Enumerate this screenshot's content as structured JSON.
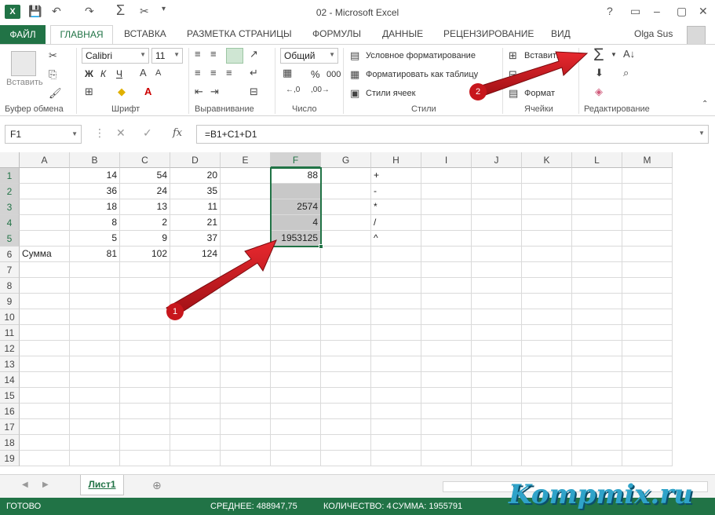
{
  "window": {
    "title": "02 - Microsoft Excel",
    "help": "?",
    "user": "Olga Sus"
  },
  "ribbon_tabs": [
    "ФАЙЛ",
    "ГЛАВНАЯ",
    "ВСТАВКА",
    "РАЗМЕТКА СТРАНИЦЫ",
    "ФОРМУЛЫ",
    "ДАННЫЕ",
    "РЕЦЕНЗИРОВАНИЕ",
    "ВИД"
  ],
  "ribbon": {
    "paste_label": "Вставить",
    "font_name": "Calibri",
    "font_size": "11",
    "bold": "Ж",
    "italic": "К",
    "underline": "Ч",
    "number_format": "Общий",
    "currency": "💳",
    "percent": "%",
    "thousands": "000",
    "cond_format": "Условное форматирование",
    "format_table": "Форматировать как таблицу",
    "cell_styles": "Стили ячеек",
    "insert": "Вставить",
    "format": "Формат",
    "groups": {
      "clipboard": "Буфер обмена",
      "font": "Шрифт",
      "alignment": "Выравнивание",
      "number": "Число",
      "styles": "Стили",
      "cells": "Ячейки",
      "editing": "Редактирование"
    }
  },
  "formula_bar": {
    "name_box": "F1",
    "fx": "fx",
    "formula": "=B1+C1+D1"
  },
  "grid": {
    "columns": [
      "A",
      "B",
      "C",
      "D",
      "E",
      "F",
      "G",
      "H",
      "I",
      "J",
      "K",
      "L",
      "M"
    ],
    "rows": [
      "1",
      "2",
      "3",
      "4",
      "5",
      "6",
      "7",
      "8",
      "9",
      "10",
      "11",
      "12",
      "13",
      "14",
      "15",
      "16",
      "17",
      "18",
      "19"
    ],
    "cells": {
      "A6": "Сумма",
      "B1": "14",
      "C1": "54",
      "D1": "20",
      "B2": "36",
      "C2": "24",
      "D2": "35",
      "B3": "18",
      "C3": "13",
      "D3": "11",
      "B4": "8",
      "C4": "2",
      "D4": "21",
      "B5": "5",
      "C5": "9",
      "D5": "37",
      "B6": "81",
      "C6": "102",
      "D6": "124",
      "F1": "88",
      "F3": "2574",
      "F4": "4",
      "F5": "1953125",
      "H1": "+",
      "H2": "-",
      "H3": "*",
      "H4": "/",
      "H5": "^"
    }
  },
  "annotations": {
    "badge1": "1",
    "badge2": "2",
    "arrow_color": "#c7161c"
  },
  "sheet": {
    "tab": "Лист1"
  },
  "status": {
    "ready": "ГОТОВО",
    "average": "СРЕДНЕЕ: 488947,75",
    "count": "КОЛИЧЕСТВО: 4",
    "sum": "СУММА: 1955791"
  },
  "watermark": "Kompmix.ru",
  "colors": {
    "accent": "#217346"
  }
}
